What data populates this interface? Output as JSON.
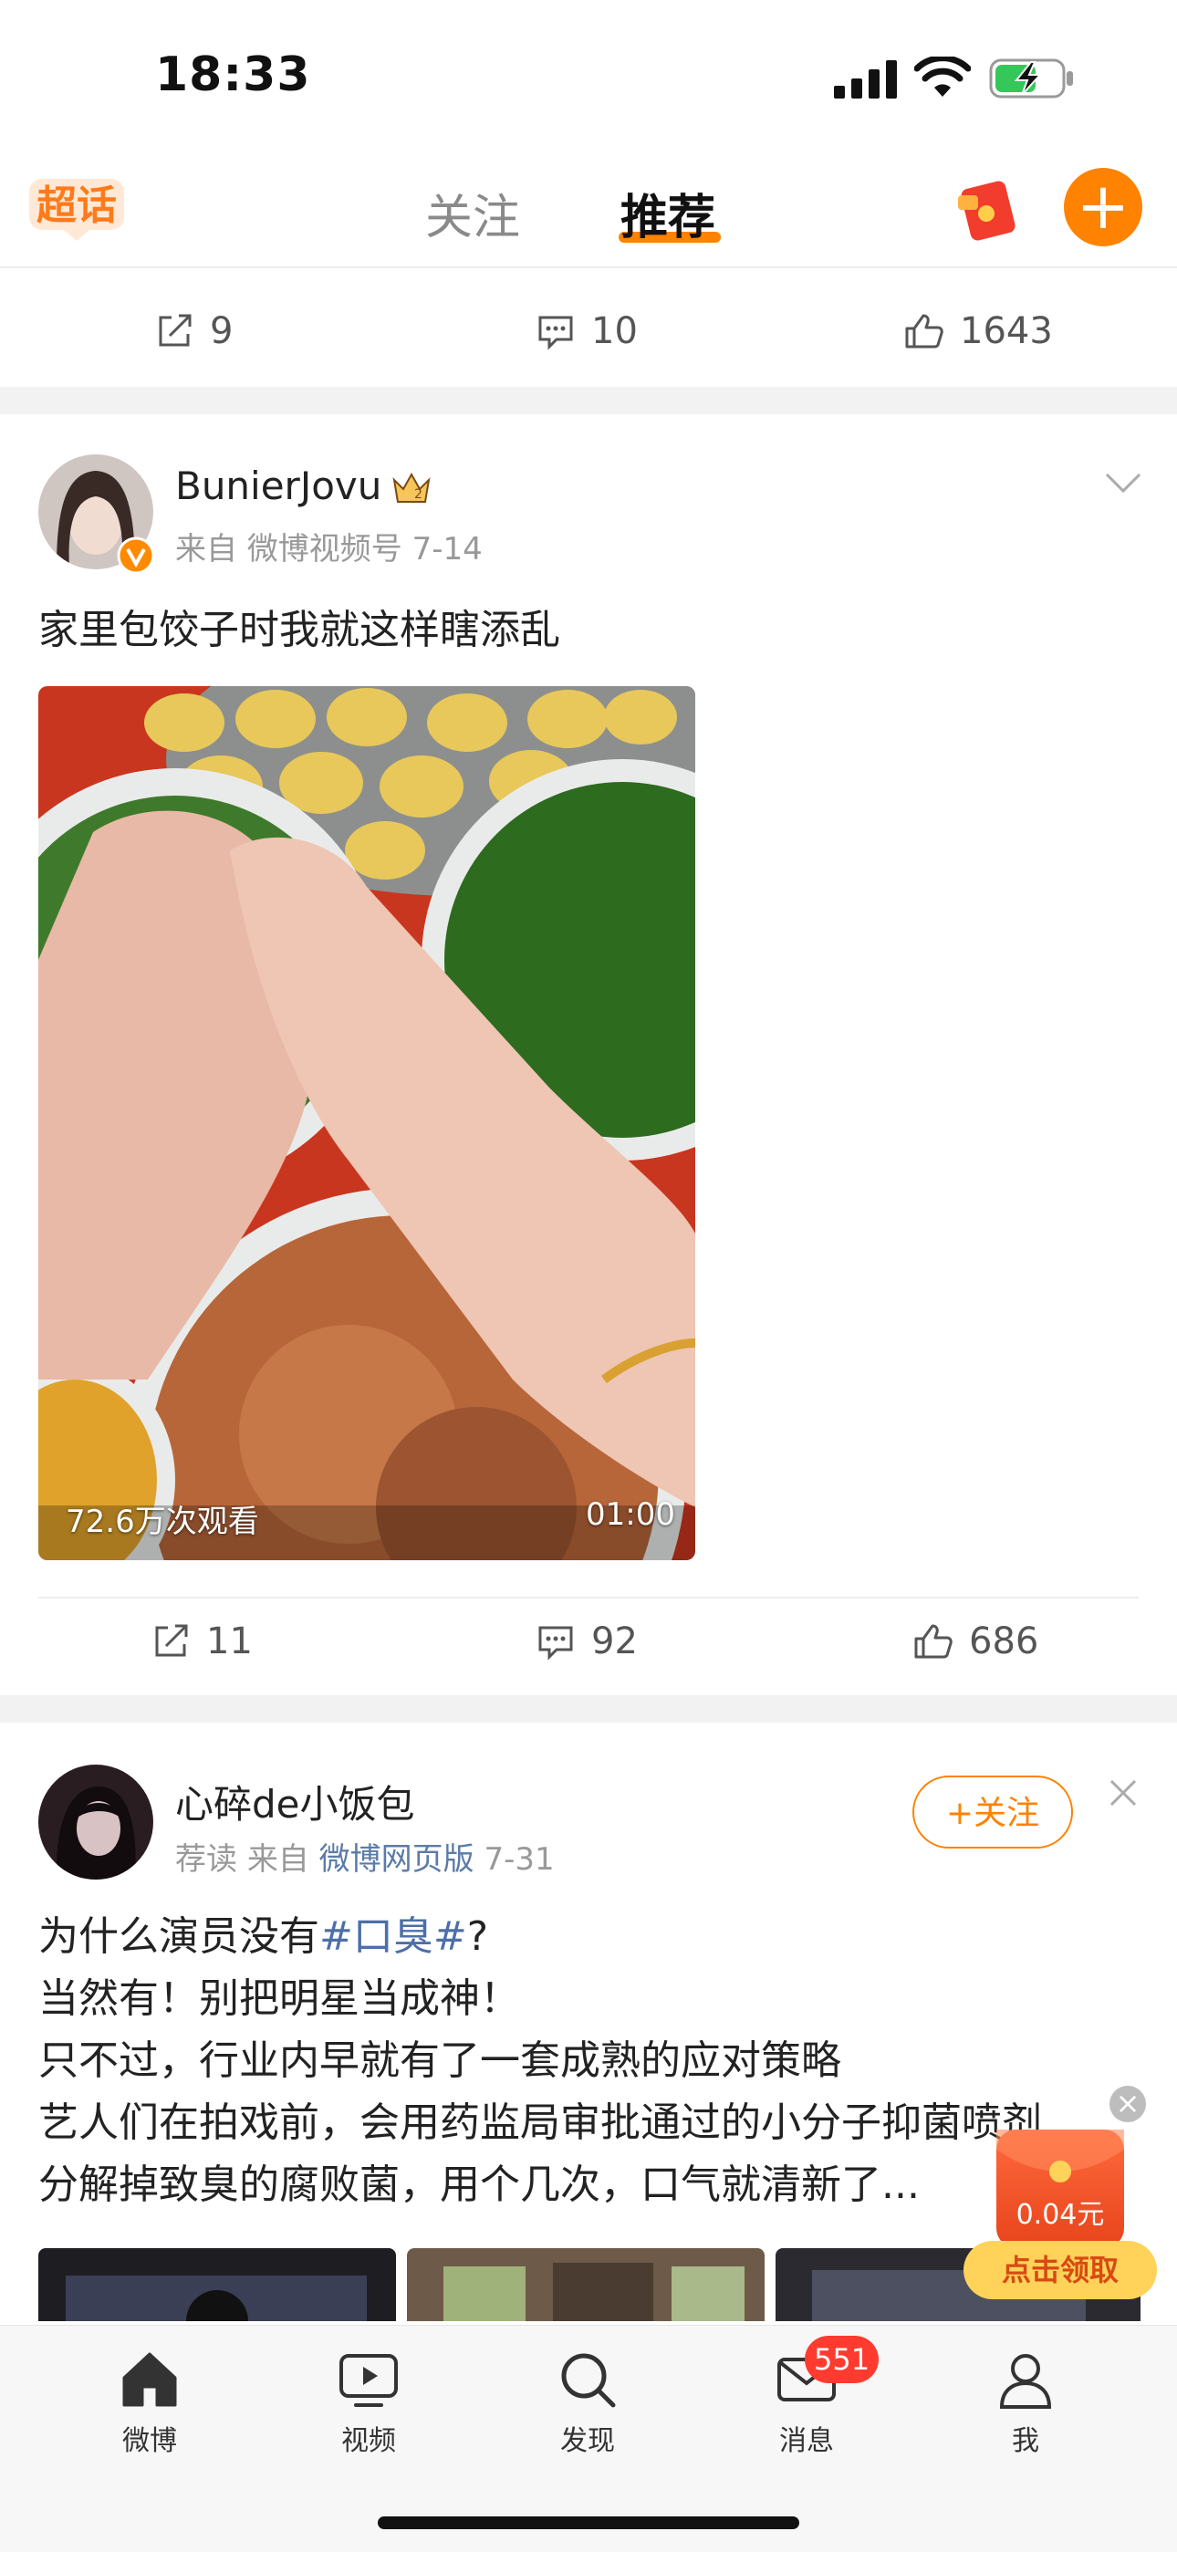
{
  "status_bar": {
    "time": "18:33"
  },
  "top_nav": {
    "supertopic_label": "超话",
    "tab_follow": "关注",
    "tab_recommend": "推荐",
    "accent": "#ff8200"
  },
  "post0_actions": {
    "reposts": "9",
    "comments": "10",
    "likes": "1643"
  },
  "post1": {
    "username": "BunierJovu",
    "meta_from": "来自",
    "meta_source": "微博视频号",
    "meta_date": "7-14",
    "text": "家里包饺子时我就这样瞎添乱",
    "video_views": "72.6万次观看",
    "video_duration": "01:00",
    "actions": {
      "reposts": "11",
      "comments": "92",
      "likes": "686"
    }
  },
  "post2": {
    "username": "心碎de小饭包",
    "meta_tag": "荐读",
    "meta_from": "来自",
    "meta_source": "微博网页版",
    "meta_date": "7-31",
    "follow_label": "+关注",
    "line1_pre": "为什么演员没有",
    "line1_tag": "#口臭#",
    "line1_post": "?",
    "line2": "当然有！别把明星当成神！",
    "line3": "只不过，行业内早就有了一套成熟的应对策略",
    "line4": "艺人们在拍戏前，会用药监局审批通过的小分子抑菌喷剂",
    "line5": "分解掉致臭的腐败菌，用个几次，口气就清新了..."
  },
  "floating_redpacket": {
    "amount": "0.04元",
    "claim_label": "点击领取"
  },
  "tabbar": {
    "weibo": "微博",
    "video": "视频",
    "discover": "发现",
    "messages": "消息",
    "messages_badge": "551",
    "me": "我"
  }
}
